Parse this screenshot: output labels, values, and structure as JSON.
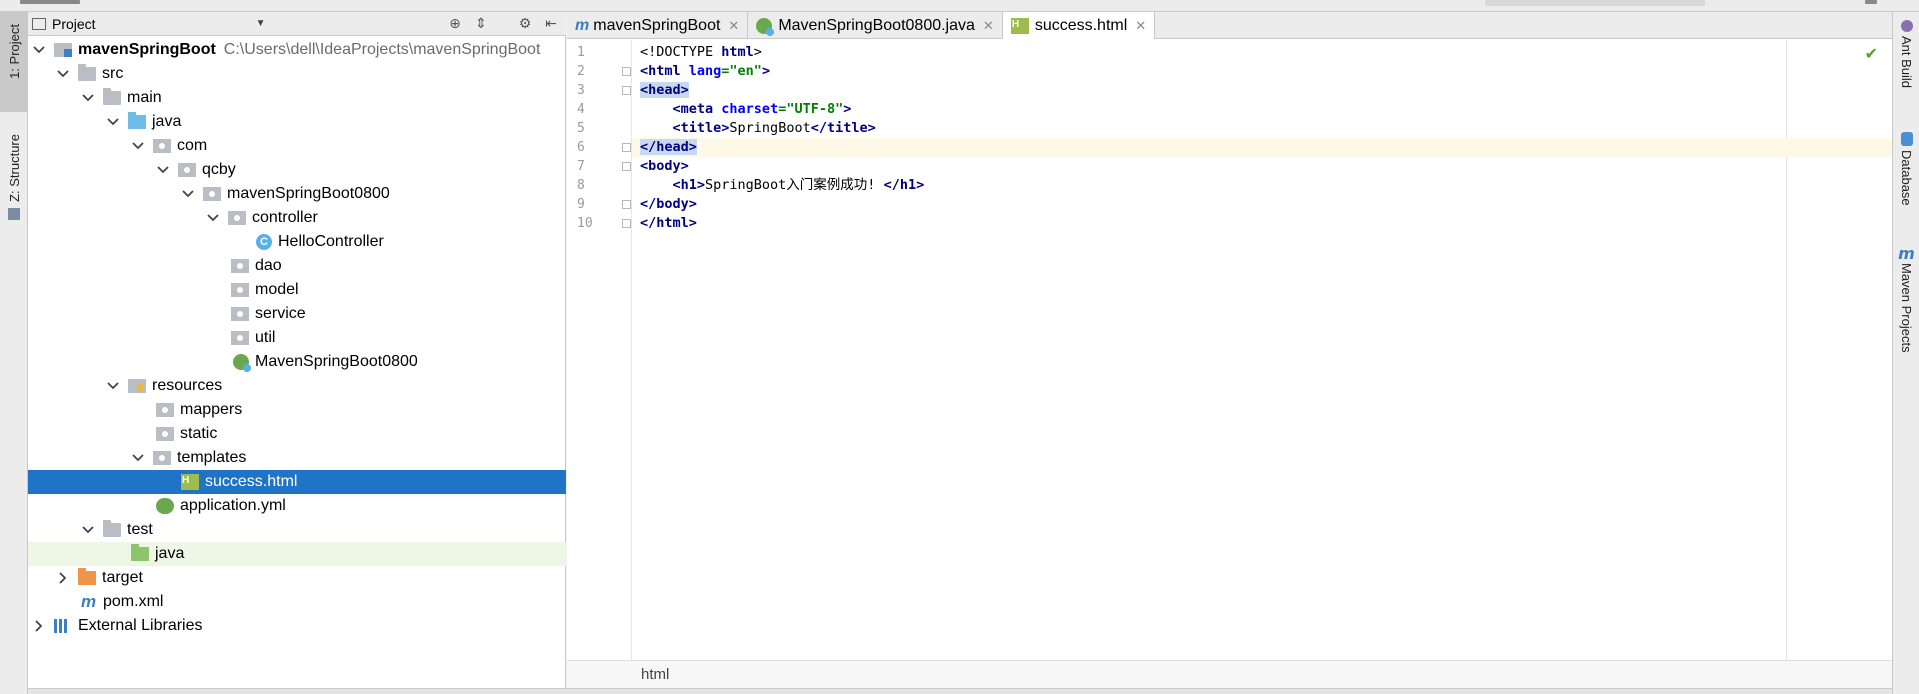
{
  "left_strip": {
    "project_tab": "1: Project",
    "structure_tab": "Z: Structure"
  },
  "right_strip": {
    "ant_build_tab": "Ant Build",
    "database_tab": "Database",
    "maven_tab": "Maven Projects"
  },
  "project_panel": {
    "title": "Project"
  },
  "tree": {
    "root": {
      "label": "mavenSpringBoot",
      "path": "C:\\Users\\dell\\IdeaProjects\\mavenSpringBoot"
    },
    "src": "src",
    "main": "main",
    "java": "java",
    "com": "com",
    "qcby": "qcby",
    "pkg": "mavenSpringBoot0800",
    "controller": "controller",
    "hello_controller": "HelloController",
    "dao": "dao",
    "model": "model",
    "service": "service",
    "util": "util",
    "app_class": "MavenSpringBoot0800",
    "resources": "resources",
    "mappers": "mappers",
    "static": "static",
    "templates": "templates",
    "success_html": "success.html",
    "application_yml": "application.yml",
    "test": "test",
    "test_java": "java",
    "target": "target",
    "pom": "pom.xml",
    "external_libraries": "External Libraries"
  },
  "tabs": [
    {
      "label": "mavenSpringBoot",
      "icon": "maven-icon"
    },
    {
      "label": "MavenSpringBoot0800.java",
      "icon": "spring-class-icon"
    },
    {
      "label": "success.html",
      "icon": "html-file-icon"
    }
  ],
  "gutter": [
    "1",
    "2",
    "3",
    "4",
    "5",
    "6",
    "7",
    "8",
    "9",
    "10"
  ],
  "code": {
    "l1_a": "<!DOCTYPE ",
    "l1_b": "html",
    "l1_c": ">",
    "l2_a": "<html ",
    "l2_attr": "lang",
    "l2_val": "=\"en\"",
    "l2_c": ">",
    "l3": "<head>",
    "l4_indent": "    ",
    "l4_a": "<meta ",
    "l4_attr": "charset",
    "l4_val": "=\"UTF-8\"",
    "l4_c": ">",
    "l5_indent": "    ",
    "l5_a": "<title>",
    "l5_text": "SpringBoot",
    "l5_c": "</title>",
    "l6": "</head>",
    "l7": "<body>",
    "l8_indent": "    ",
    "l8_a": "<h1>",
    "l8_text": "SpringBoot入门案例成功! ",
    "l8_c": "</h1>",
    "l9": "</body>",
    "l10": "</html>"
  },
  "breadcrumb": "html",
  "colors": {
    "selection": "#1f74c8",
    "tag": "#000080",
    "attr": "#0000ff",
    "value": "#008000",
    "current_line": "#fdf9e6"
  }
}
